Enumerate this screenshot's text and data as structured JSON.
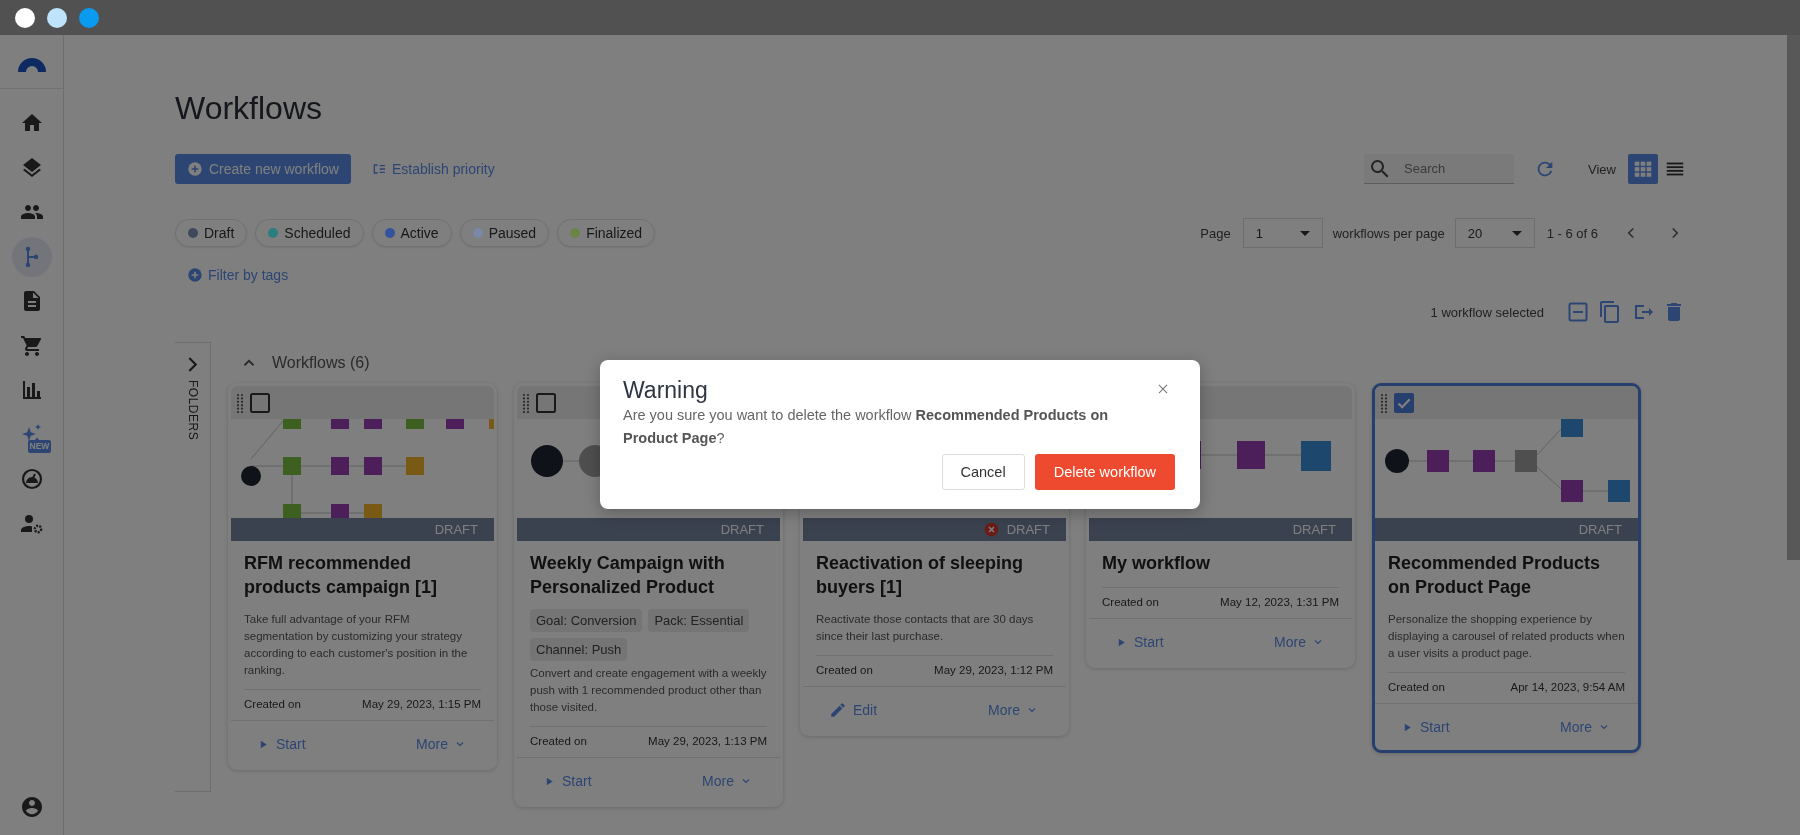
{
  "sidebar": {
    "items": [
      {
        "selected": false
      },
      {
        "selected": false
      },
      {
        "selected": false
      },
      {
        "selected": true
      },
      {
        "selected": false
      },
      {
        "selected": false
      },
      {
        "selected": false
      },
      {
        "selected": false,
        "badge": "NEW"
      },
      {
        "selected": false
      },
      {
        "selected": false
      }
    ],
    "footer_items": [
      {
        "selected": false
      }
    ]
  },
  "page": {
    "title": "Workflows"
  },
  "toolbar": {
    "create_button": "Create new workflow",
    "priority_link": "Establish priority",
    "search": {
      "placeholder": "Search"
    },
    "view_label": "View",
    "views": [
      {
        "kind": "grid",
        "selected": true
      },
      {
        "kind": "list",
        "selected": false
      }
    ]
  },
  "filters": [
    {
      "label": "Draft",
      "color": "#3e4a5c"
    },
    {
      "label": "Scheduled",
      "color": "#2c7d80"
    },
    {
      "label": "Active",
      "color": "#33539a"
    },
    {
      "label": "Paused",
      "color": "#7b87a6"
    },
    {
      "label": "Finalized",
      "color": "#6b8548"
    }
  ],
  "filter_by_tags": "Filter by tags",
  "pagination": {
    "page_label": "Page",
    "page": "1",
    "per_page_label": "workflows per page",
    "per_page": "20",
    "range": "1 - 6 of 6"
  },
  "selection": {
    "text": "1 workflow selected"
  },
  "folders": {
    "label": "FOLDERS",
    "expanded": false
  },
  "section": {
    "title": "Workflows (6)",
    "expanded": true
  },
  "cards": [
    {
      "checked": false,
      "status": "DRAFT",
      "error": false,
      "title": "RFM recommended products campaign [1]",
      "description": "Take full advantage of your RFM segmentation by customizing your strategy according to each customer's position in the ranking.",
      "created_label": "Created on",
      "created": "May 29, 2023, 1:15 PM",
      "action": {
        "kind": "start",
        "label": "Start"
      },
      "more": "More"
    },
    {
      "checked": false,
      "status": "DRAFT",
      "error": false,
      "title": "Weekly Campaign with Personalized Product",
      "tags": [
        "Goal: Conversion",
        "Pack: Essential",
        "Channel: Push"
      ],
      "description": "Convert and create engagement with a weekly push with 1 recommended product other than those visited.",
      "created_label": "Created on",
      "created": "May 29, 2023, 1:13 PM",
      "action": {
        "kind": "start",
        "label": "Start"
      },
      "more": "More"
    },
    {
      "status": "DRAFT",
      "error": true,
      "title": "Reactivation of sleeping buyers [1]",
      "description": "Reactivate those contacts that are 30 days since their last purchase.",
      "created_label": "Created on",
      "created": "May 29, 2023, 1:12 PM",
      "action": {
        "kind": "edit",
        "label": "Edit"
      },
      "more": "More"
    },
    {
      "status": "DRAFT",
      "error": false,
      "title": "My workflow",
      "created_label": "Created on",
      "created": "May 12, 2023, 1:31 PM",
      "action": {
        "kind": "start",
        "label": "Start"
      },
      "more": "More"
    },
    {
      "checked": true,
      "status": "DRAFT",
      "error": false,
      "title": "Recommended Products on Product Page",
      "description": "Personalize the shopping experience by displaying a carousel of related products when a user visits a product page.",
      "created_label": "Created on",
      "created": "Apr 14, 2023, 9:54 AM",
      "action": {
        "kind": "start",
        "label": "Start"
      },
      "more": "More"
    }
  ],
  "dialog": {
    "title": "Warning",
    "message": "Are you sure you want to delete the workflow **Recommended Products on Product Page**?",
    "cancel": "Cancel",
    "confirm": "Delete workflow"
  }
}
